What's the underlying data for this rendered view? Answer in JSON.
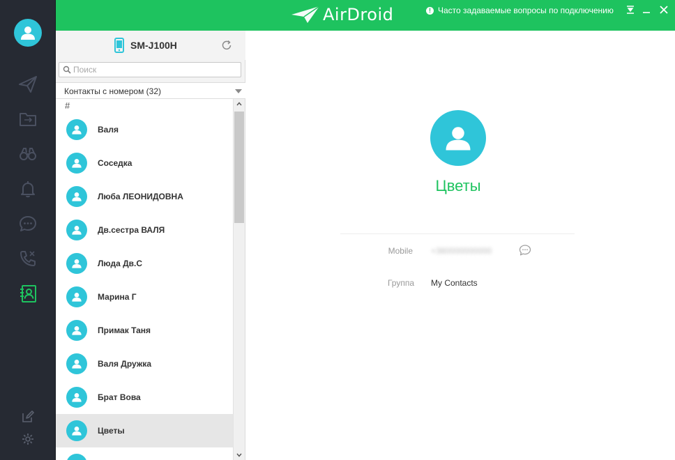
{
  "app": {
    "logo_text": "AirDroid",
    "faq_text": "Часто задаваемые вопросы по подключению"
  },
  "sidebar": {
    "items": [
      {
        "icon": "send-icon",
        "active": false
      },
      {
        "icon": "file-transfer-icon",
        "active": false
      },
      {
        "icon": "binoculars-icon",
        "active": false
      },
      {
        "icon": "bell-icon",
        "active": false
      },
      {
        "icon": "chat-icon",
        "active": false
      },
      {
        "icon": "calls-icon",
        "active": false
      },
      {
        "icon": "contacts-icon",
        "active": true
      }
    ],
    "bottom": [
      "edit-icon",
      "gear-icon"
    ]
  },
  "device": {
    "name": "SM-J100H"
  },
  "search": {
    "placeholder": "Поиск"
  },
  "filter": {
    "label": "Контакты с номером (32)"
  },
  "section": {
    "header": "#"
  },
  "contacts": [
    {
      "name": "Валя"
    },
    {
      "name": "Соседка"
    },
    {
      "name": "Люба ЛЕОНИДОВНА"
    },
    {
      "name": "Дв.сестра ВАЛЯ"
    },
    {
      "name": "Люда Дв.С"
    },
    {
      "name": "Марина Г"
    },
    {
      "name": "Примак Таня"
    },
    {
      "name": "Валя Дружка"
    },
    {
      "name": "Брат Вова"
    },
    {
      "name": "Цветы"
    }
  ],
  "selected_index": 9,
  "detail": {
    "name": "Цветы",
    "fields": [
      {
        "label": "Mobile",
        "value": "+380000000000"
      },
      {
        "label": "Группа",
        "value": "My Contacts"
      }
    ]
  },
  "colors": {
    "brand_green": "#1ec35f",
    "avatar_cyan": "#2fc5d9",
    "sidebar_bg": "#262a33"
  }
}
